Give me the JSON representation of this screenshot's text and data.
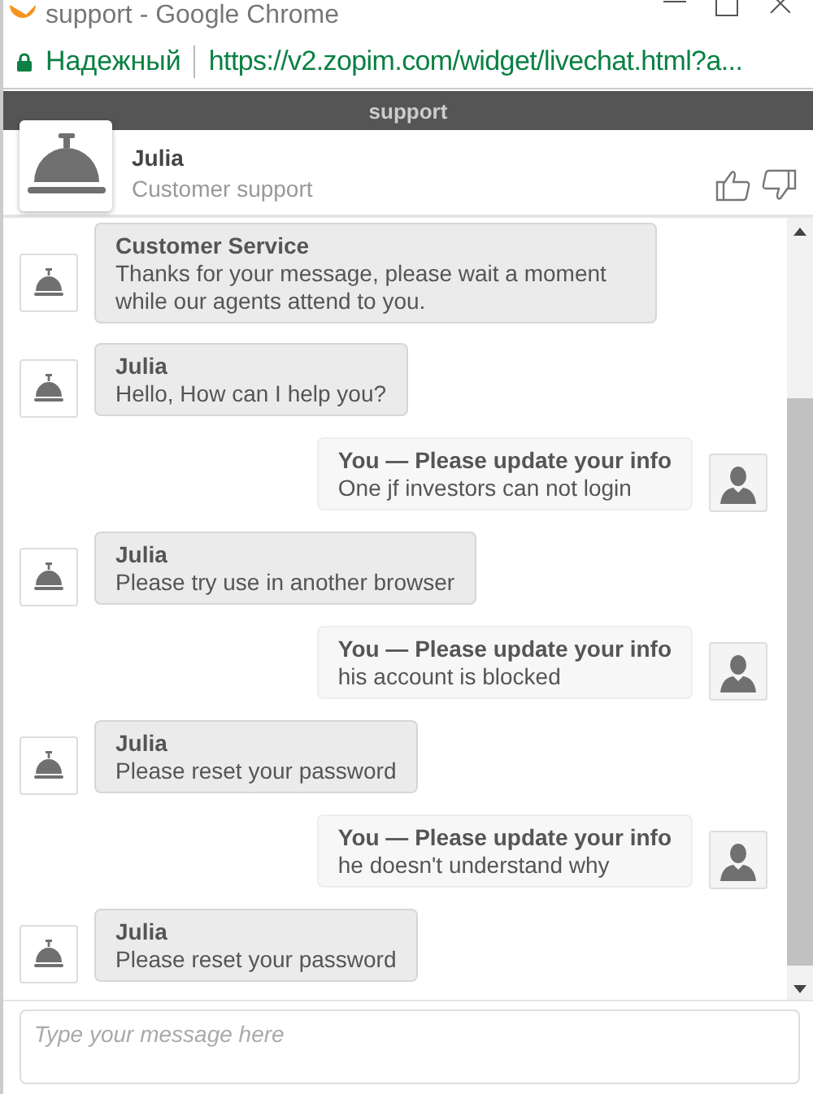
{
  "window": {
    "title": "support - Google Chrome"
  },
  "address_bar": {
    "security_label": "Надежный",
    "url": "https://v2.zopim.com/widget/livechat.html?a..."
  },
  "widget": {
    "title": "support"
  },
  "agent": {
    "name": "Julia",
    "role": "Customer support"
  },
  "messages": [
    {
      "kind": "agent",
      "name": "Customer Service",
      "text": "Thanks for your message, please wait a moment while our agents attend to you."
    },
    {
      "kind": "agent",
      "name": "Julia",
      "text": "Hello, How can I help you?"
    },
    {
      "kind": "visitor",
      "name": "You — Please update your info",
      "text": "One jf investors can not login"
    },
    {
      "kind": "agent",
      "name": "Julia",
      "text": "Please try use in another browser"
    },
    {
      "kind": "visitor",
      "name": "You — Please update your info",
      "text": "his account is blocked"
    },
    {
      "kind": "agent",
      "name": "Julia",
      "text": "Please reset your password"
    },
    {
      "kind": "visitor",
      "name": "You — Please update your info",
      "text": "he doesn't understand why"
    },
    {
      "kind": "agent",
      "name": "Julia",
      "text": "Please reset your password"
    }
  ],
  "composer": {
    "placeholder": "Type your message here"
  }
}
